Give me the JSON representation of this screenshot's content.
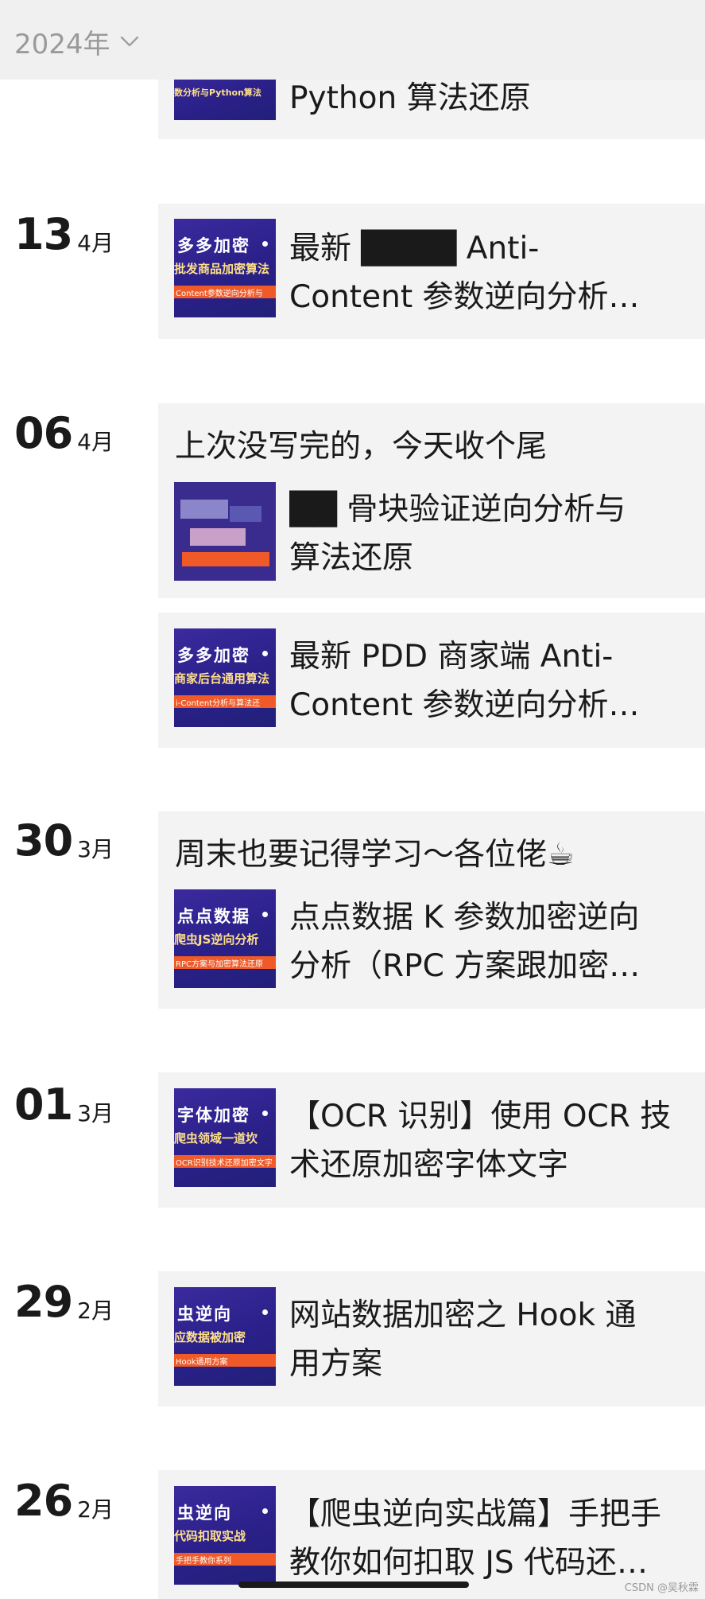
{
  "header": {
    "year_label": "2024年",
    "chevron_icon": "chevron-down-icon"
  },
  "posts": [
    {
      "date_day": "",
      "date_month": "",
      "intro": "",
      "thumb": {
        "title": "",
        "subtitle": "数分析与Python算法",
        "strip": ""
      },
      "line1": "Python 算法还原",
      "line2": ""
    },
    {
      "date_day": "13",
      "date_month": "4月",
      "intro": "",
      "thumb": {
        "title": "多多加密",
        "subtitle": "批发商品加密算法",
        "strip": "Content参数逆向分析与"
      },
      "line1": "最新 ████ Anti-",
      "line2": "Content 参数逆向分析…"
    },
    {
      "date_day": "06",
      "date_month": "4月",
      "intro": "上次没写完的，今天收个尾",
      "thumb": {
        "title": "",
        "subtitle": "",
        "strip": ""
      },
      "line1": "██ 骨块验证逆向分析与",
      "line2": "算法还原"
    },
    {
      "date_day": "",
      "date_month": "",
      "intro": "",
      "thumb": {
        "title": "多多加密",
        "subtitle": "商家后台通用算法",
        "strip": "i-Content分析与算法还"
      },
      "line1": "最新 PDD 商家端 Anti-",
      "line2": "Content 参数逆向分析…"
    },
    {
      "date_day": "30",
      "date_month": "3月",
      "intro": "周末也要记得学习～各位佬☕",
      "thumb": {
        "title": "点点数据",
        "subtitle": "爬虫JS逆向分析",
        "strip": "RPC方案与加密算法还原"
      },
      "line1": "点点数据 K 参数加密逆向",
      "line2": "分析（RPC 方案跟加密…"
    },
    {
      "date_day": "01",
      "date_month": "3月",
      "intro": "",
      "thumb": {
        "title": "字体加密",
        "subtitle": "爬虫领域一道坎",
        "strip": "OCR识别技术还原加密文字"
      },
      "line1": "【OCR 识别】使用 OCR 技",
      "line2": "术还原加密字体文字"
    },
    {
      "date_day": "29",
      "date_month": "2月",
      "intro": "",
      "thumb": {
        "title": "虫逆向",
        "subtitle": "应数据被加密",
        "strip": "Hook通用方案"
      },
      "line1": "网站数据加密之 Hook 通",
      "line2": "用方案"
    },
    {
      "date_day": "26",
      "date_month": "2月",
      "intro": "",
      "thumb": {
        "title": "虫逆向",
        "subtitle": "代码扣取实战",
        "strip": "手把手教你系列"
      },
      "line1": "【爬虫逆向实战篇】手把手",
      "line2": "教你如何扣取 JS 代码还…"
    }
  ],
  "footer": {
    "watermark": "CSDN @吴秋霖"
  }
}
